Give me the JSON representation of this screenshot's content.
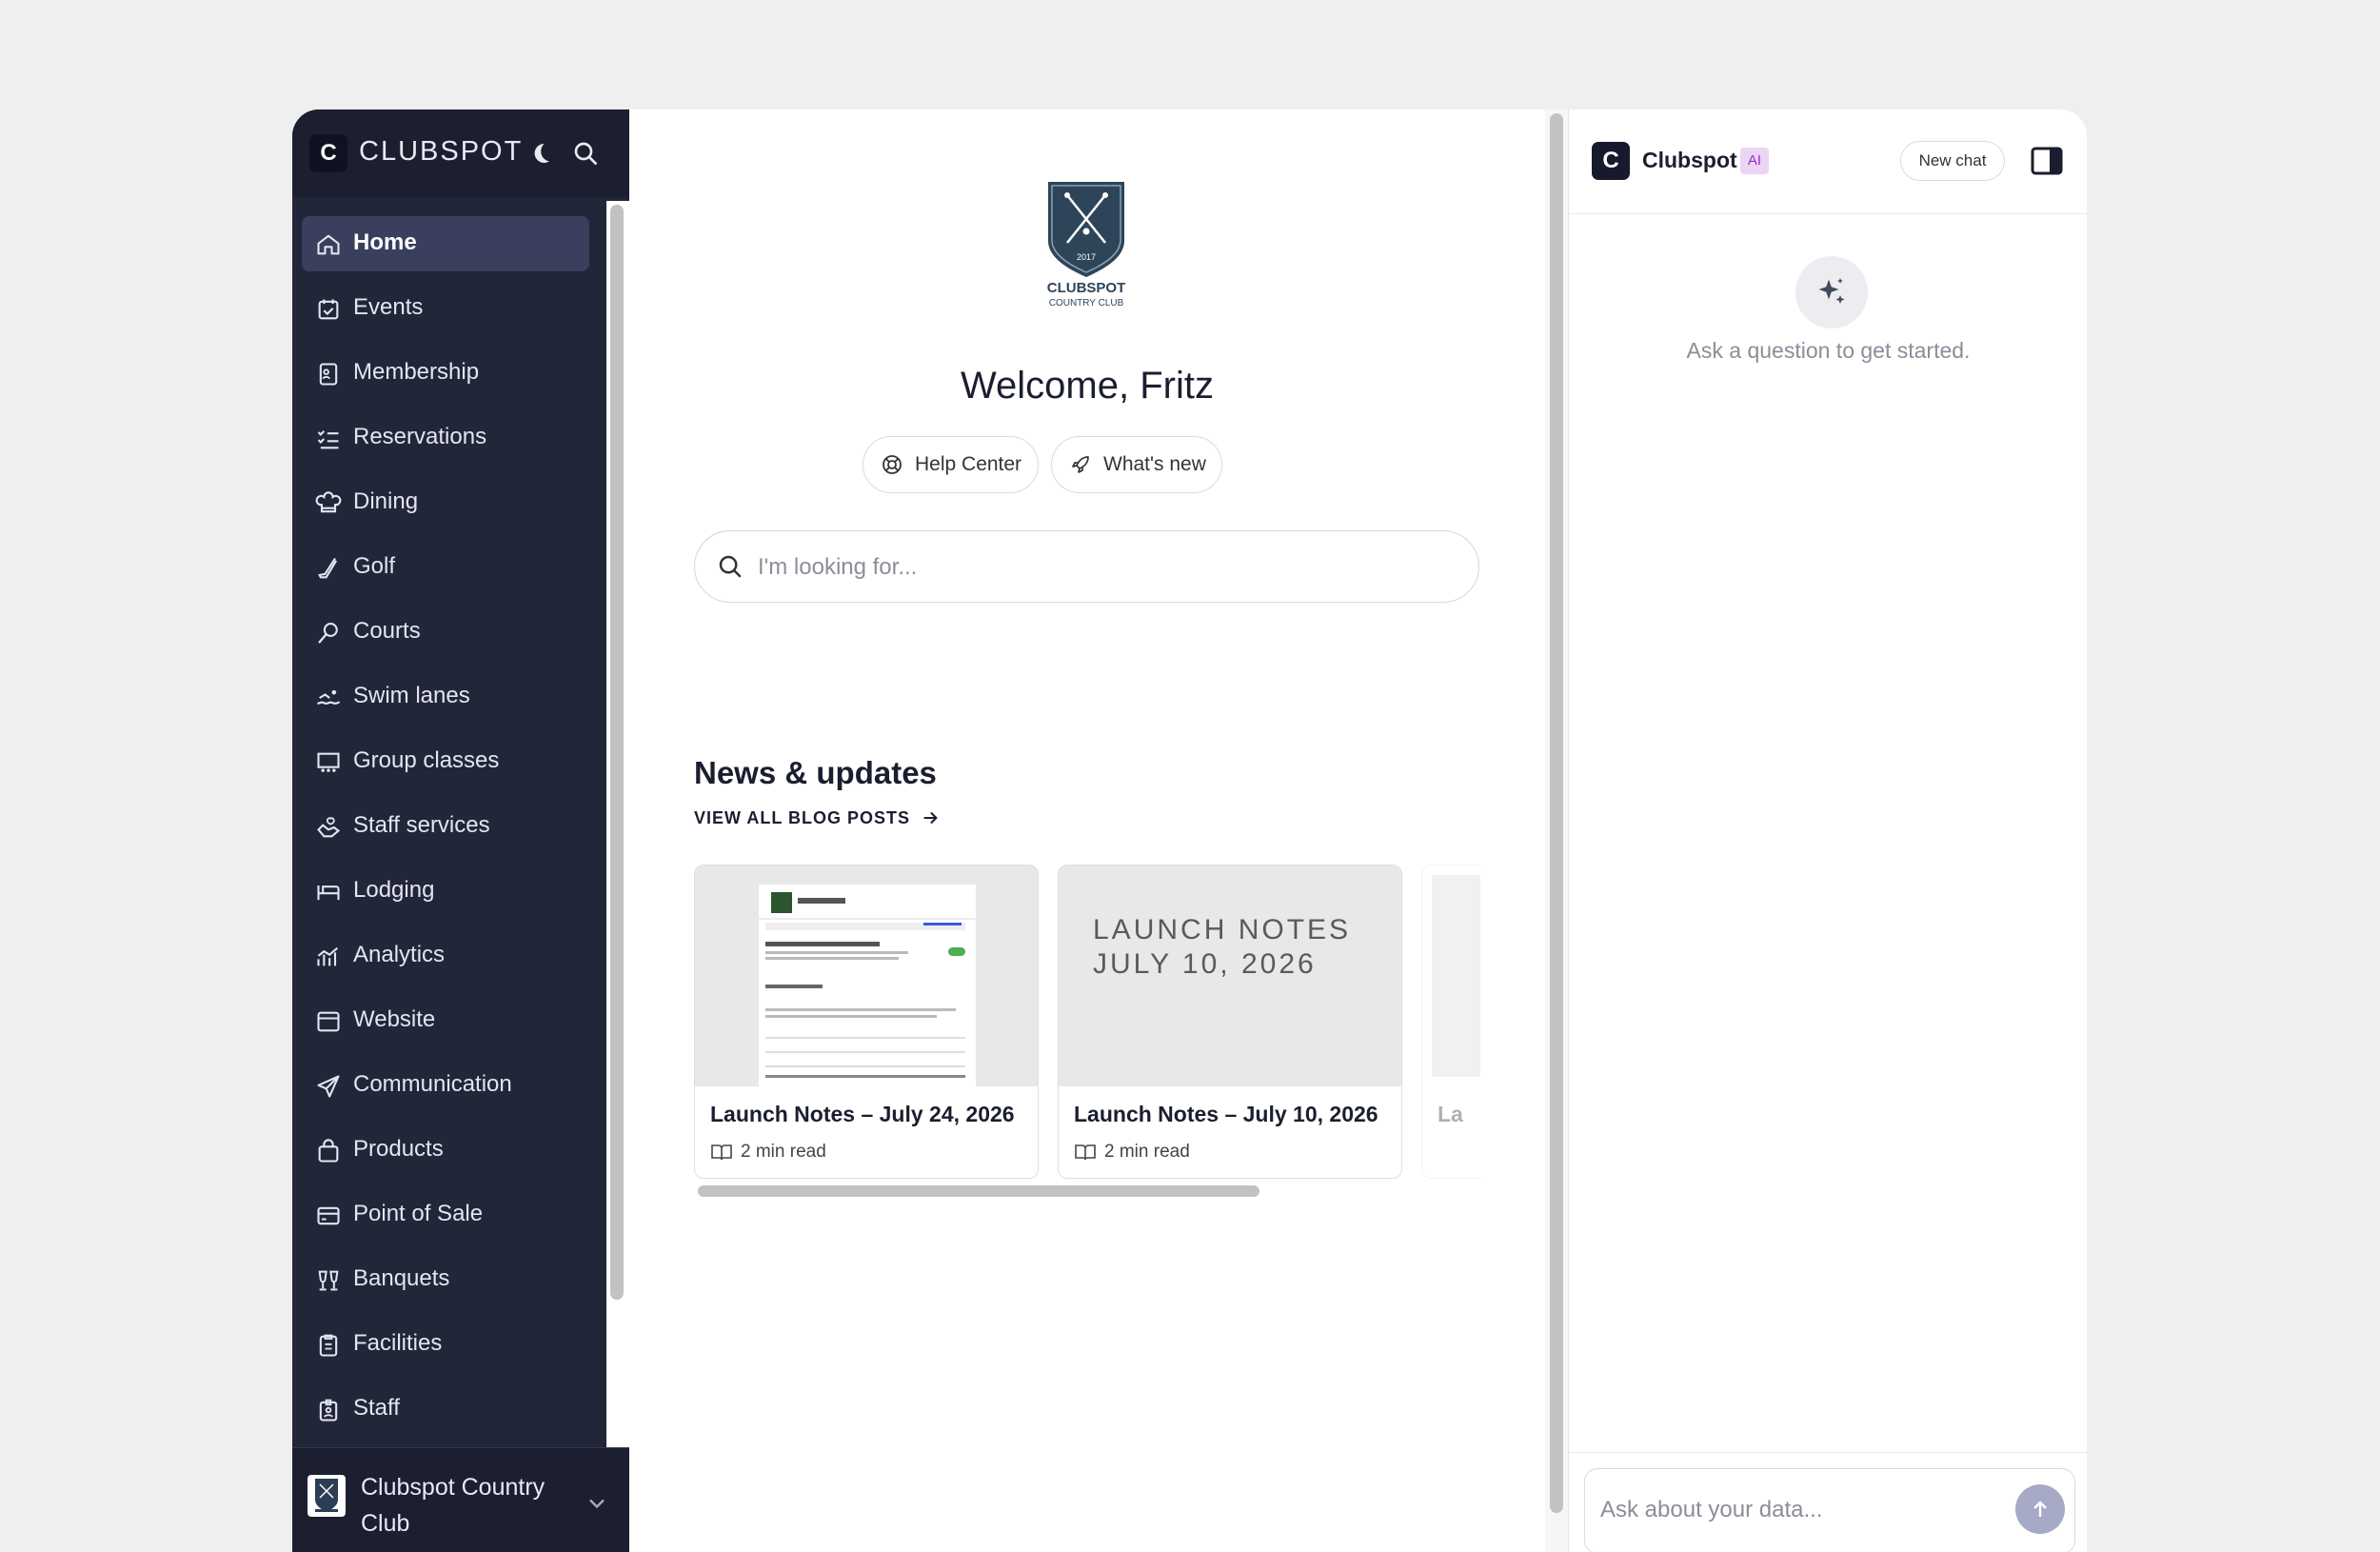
{
  "sidebar": {
    "brand": {
      "logo_letter": "C",
      "name": "CLUBSPOT"
    },
    "items": [
      {
        "label": "Home",
        "icon": "home-icon",
        "active": true
      },
      {
        "label": "Events",
        "icon": "calendar-check-icon"
      },
      {
        "label": "Membership",
        "icon": "id-card-icon"
      },
      {
        "label": "Reservations",
        "icon": "list-check-icon"
      },
      {
        "label": "Dining",
        "icon": "chef-hat-icon"
      },
      {
        "label": "Golf",
        "icon": "golf-club-icon"
      },
      {
        "label": "Courts",
        "icon": "racket-icon"
      },
      {
        "label": "Swim lanes",
        "icon": "swimmer-icon"
      },
      {
        "label": "Group classes",
        "icon": "presentation-icon"
      },
      {
        "label": "Staff services",
        "icon": "hand-heart-icon"
      },
      {
        "label": "Lodging",
        "icon": "bed-icon"
      },
      {
        "label": "Analytics",
        "icon": "chart-icon"
      },
      {
        "label": "Website",
        "icon": "browser-icon"
      },
      {
        "label": "Communication",
        "icon": "send-icon"
      },
      {
        "label": "Products",
        "icon": "bag-icon"
      },
      {
        "label": "Point of Sale",
        "icon": "credit-card-icon"
      },
      {
        "label": "Banquets",
        "icon": "glasses-icon"
      },
      {
        "label": "Facilities",
        "icon": "clipboard-icon"
      },
      {
        "label": "Staff",
        "icon": "badge-icon"
      }
    ],
    "footer": {
      "club_name": "Clubspot Country Club"
    }
  },
  "main": {
    "crest": {
      "text_top": "CLUBSPOT",
      "text_bottom": "COUNTRY CLUB",
      "year": "2017"
    },
    "welcome": "Welcome, Fritz",
    "pills": [
      {
        "label": "Help Center",
        "icon": "lifebuoy-icon"
      },
      {
        "label": "What's new",
        "icon": "rocket-icon"
      }
    ],
    "search": {
      "placeholder": "I'm looking for...",
      "value": ""
    },
    "news": {
      "title": "News & updates",
      "view_all": "VIEW ALL BLOG POSTS",
      "cards": [
        {
          "title": "Launch Notes – July 24, 2026",
          "meta": "2 min read",
          "thumb": "screenshot"
        },
        {
          "title": "Launch Notes – July 10, 2026",
          "meta": "2 min read",
          "thumb": "text",
          "thumb_text_1": "LAUNCH NOTES",
          "thumb_text_2": "JULY 10, 2026"
        },
        {
          "title": "La",
          "meta": "",
          "thumb": "partial"
        }
      ]
    }
  },
  "ai": {
    "logo_letter": "C",
    "title": "Clubspot",
    "badge": "AI",
    "new_chat": "New chat",
    "empty_text": "Ask a question to get started.",
    "input_placeholder": "Ask about your data...",
    "input_value": ""
  }
}
